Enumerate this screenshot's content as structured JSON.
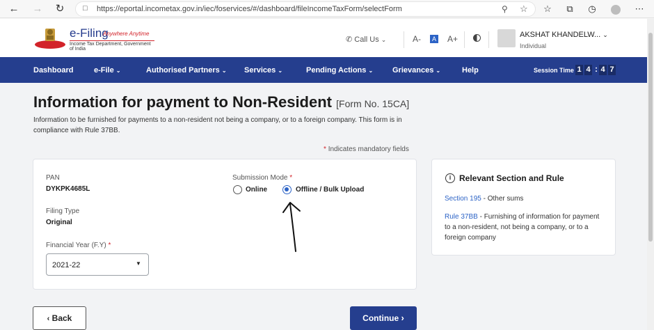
{
  "browser": {
    "url": "https://eportal.incometax.gov.in/iec/foservices/#/dashboard/fileIncomeTaxForm/selectForm"
  },
  "header": {
    "logo_title": "e-Filing",
    "logo_tagline": "Anywhere Anytime",
    "logo_dept": "Income Tax Department, Government of India",
    "call_us": "Call Us",
    "font_decrease": "A-",
    "font_default": "A",
    "font_increase": "A+",
    "user_name": "AKSHAT KHANDELW...",
    "user_role": "Individual"
  },
  "nav": {
    "items": [
      {
        "label": "Dashboard"
      },
      {
        "label": "e-File"
      },
      {
        "label": "Authorised Partners"
      },
      {
        "label": "Services"
      },
      {
        "label": "Pending Actions"
      },
      {
        "label": "Grievances"
      },
      {
        "label": "Help"
      }
    ],
    "session_label": "Session Time",
    "session_digits": [
      "1",
      "4",
      "4",
      "7"
    ]
  },
  "main": {
    "title": "Information for payment to Non-Resident",
    "form_no": "[Form No. 15CA]",
    "description": "Information to be furnished for payments to a non-resident not being a company, or to a foreign company. This form is in compliance with Rule 37BB.",
    "mandatory_note": "Indicates mandatory fields"
  },
  "form": {
    "pan_label": "PAN",
    "pan_value": "DYKPK4685L",
    "filing_type_label": "Filing Type",
    "filing_type_value": "Original",
    "fy_label": "Financial Year (F.Y)",
    "fy_value": "2021-22",
    "submission_mode_label": "Submission Mode",
    "mode_online": "Online",
    "mode_offline": "Offline / Bulk Upload",
    "selected_mode": "Offline / Bulk Upload"
  },
  "info": {
    "title": "Relevant Section and Rule",
    "section_link": "Section 195",
    "section_text": " - Other sums",
    "rule_link": "Rule 37BB",
    "rule_text": " - Furnishing of information for payment to a non-resident, not being a company, or to a foreign company"
  },
  "actions": {
    "back_label": "Back",
    "continue_label": "Continue"
  },
  "colors": {
    "nav_bg": "#253e8e",
    "accent": "#2c63c6",
    "required": "#d2232a"
  }
}
